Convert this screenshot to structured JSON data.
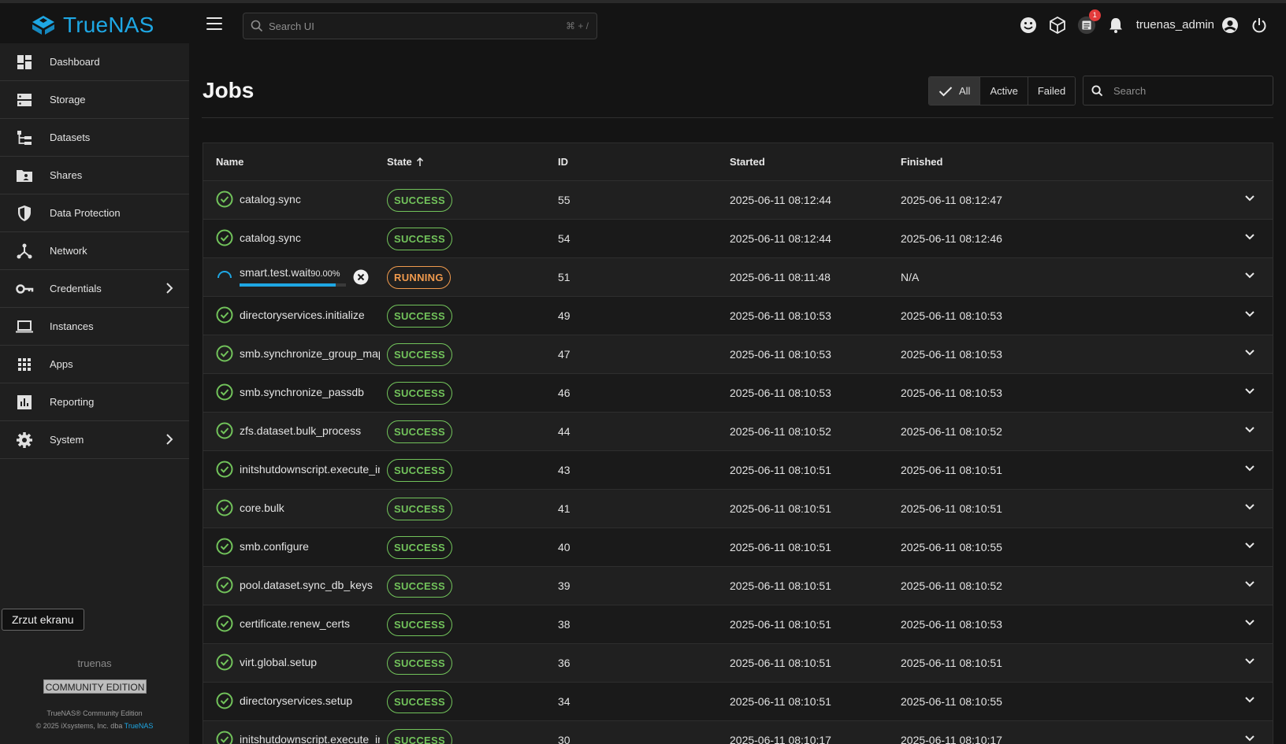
{
  "app": {
    "name": "TrueNAS"
  },
  "topbar": {
    "search_placeholder": "Search UI",
    "search_shortcut": "⌘ + /",
    "tasks_badge": "1",
    "username": "truenas_admin"
  },
  "sidebar": {
    "items": [
      {
        "label": "Dashboard"
      },
      {
        "label": "Storage"
      },
      {
        "label": "Datasets"
      },
      {
        "label": "Shares"
      },
      {
        "label": "Data Protection"
      },
      {
        "label": "Network"
      },
      {
        "label": "Credentials"
      },
      {
        "label": "Instances"
      },
      {
        "label": "Apps"
      },
      {
        "label": "Reporting"
      },
      {
        "label": "System"
      }
    ],
    "tooltip": "Zrzut ekranu",
    "hostname": "truenas",
    "edition": "COMMUNITY EDITION",
    "copyright_line1": "TrueNAS® Community Edition",
    "copyright_line2": "© 2025 iXsystems, Inc. dba",
    "copyright_link": "TrueNAS"
  },
  "page": {
    "title": "Jobs",
    "filters": {
      "all": "All",
      "active": "Active",
      "failed": "Failed"
    },
    "search_placeholder": "Search"
  },
  "table": {
    "columns": {
      "name": "Name",
      "state": "State",
      "id": "ID",
      "started": "Started",
      "finished": "Finished"
    },
    "running": {
      "name": "smart.test.wait",
      "progress_label": "90.00%",
      "progress": 0.9,
      "state": "RUNNING",
      "id": "51",
      "started": "2025-06-11 08:11:48",
      "finished": "N/A"
    },
    "rows": [
      {
        "name": "catalog.sync",
        "state": "SUCCESS",
        "id": "55",
        "started": "2025-06-11 08:12:44",
        "finished": "2025-06-11 08:12:47"
      },
      {
        "name": "catalog.sync",
        "state": "SUCCESS",
        "id": "54",
        "started": "2025-06-11 08:12:44",
        "finished": "2025-06-11 08:12:46"
      },
      {
        "name": "directoryservices.initialize",
        "state": "SUCCESS",
        "id": "49",
        "started": "2025-06-11 08:10:53",
        "finished": "2025-06-11 08:10:53"
      },
      {
        "name": "smb.synchronize_group_mappings",
        "state": "SUCCESS",
        "id": "47",
        "started": "2025-06-11 08:10:53",
        "finished": "2025-06-11 08:10:53"
      },
      {
        "name": "smb.synchronize_passdb",
        "state": "SUCCESS",
        "id": "46",
        "started": "2025-06-11 08:10:53",
        "finished": "2025-06-11 08:10:53"
      },
      {
        "name": "zfs.dataset.bulk_process",
        "state": "SUCCESS",
        "id": "44",
        "started": "2025-06-11 08:10:52",
        "finished": "2025-06-11 08:10:52"
      },
      {
        "name": "initshutdownscript.execute_init_tasks",
        "state": "SUCCESS",
        "id": "43",
        "started": "2025-06-11 08:10:51",
        "finished": "2025-06-11 08:10:51"
      },
      {
        "name": "core.bulk",
        "state": "SUCCESS",
        "id": "41",
        "started": "2025-06-11 08:10:51",
        "finished": "2025-06-11 08:10:51"
      },
      {
        "name": "smb.configure",
        "state": "SUCCESS",
        "id": "40",
        "started": "2025-06-11 08:10:51",
        "finished": "2025-06-11 08:10:55"
      },
      {
        "name": "pool.dataset.sync_db_keys",
        "state": "SUCCESS",
        "id": "39",
        "started": "2025-06-11 08:10:51",
        "finished": "2025-06-11 08:10:52"
      },
      {
        "name": "certificate.renew_certs",
        "state": "SUCCESS",
        "id": "38",
        "started": "2025-06-11 08:10:51",
        "finished": "2025-06-11 08:10:53"
      },
      {
        "name": "virt.global.setup",
        "state": "SUCCESS",
        "id": "36",
        "started": "2025-06-11 08:10:51",
        "finished": "2025-06-11 08:10:51"
      },
      {
        "name": "directoryservices.setup",
        "state": "SUCCESS",
        "id": "34",
        "started": "2025-06-11 08:10:51",
        "finished": "2025-06-11 08:10:55"
      },
      {
        "name": "initshutdownscript.execute_init_tasks",
        "state": "SUCCESS",
        "id": "30",
        "started": "2025-06-11 08:10:17",
        "finished": "2025-06-11 08:10:17"
      }
    ]
  }
}
